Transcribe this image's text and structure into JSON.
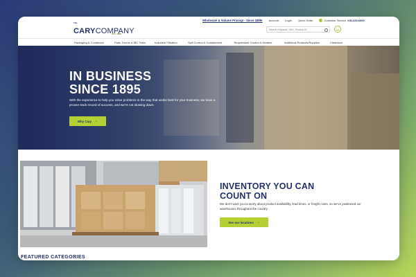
{
  "header": {
    "logo_prefix": "The",
    "logo_bold": "CARY",
    "logo_rest": "COMPANY",
    "logo_tagline": "Est. 1895",
    "promo": "Wholesale & Volume Pricing! - Since 1895!",
    "links": [
      "Account",
      "Login",
      "Quick Order"
    ],
    "phone_label": "Customer Service",
    "phone_number": "630.629.6600",
    "search_placeholder": "Search Keyword, SKU, Product ID"
  },
  "nav": {
    "items": [
      "Packaging & Containers",
      "Pails, Drums & IBC Totes",
      "Industrial Filtration",
      "Spill Control & Containment",
      "Temperature Control & Heaters",
      "Additional Products/Supplies",
      "Clearance"
    ]
  },
  "hero": {
    "title_line1": "IN BUSINESS",
    "title_line2": "SINCE 1895",
    "text": "With the experience to help you solve problems in the way that works best for your business, we have a proven track record of success, and we're not slowing down.",
    "button": "Why Cary"
  },
  "inventory": {
    "title_line1": "INVENTORY YOU CAN",
    "title_line2": "COUNT ON",
    "text": "We don't want you to worry about product availability, lead times, or freight costs, so we've positioned our warehouses throughout the country.",
    "button": "See our locations"
  },
  "featured": "FEATURED CATEGORIES",
  "colors": {
    "navy": "#24306b",
    "accent_green": "#b5d034"
  }
}
